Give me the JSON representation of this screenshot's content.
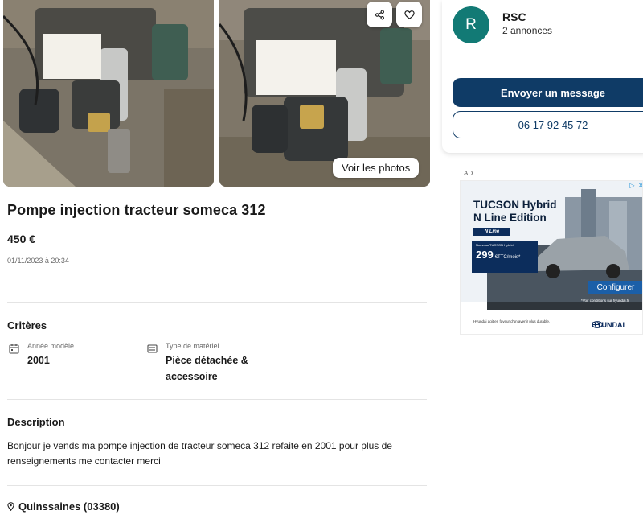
{
  "gallery": {
    "see_photos_label": "Voir les photos",
    "photo1_handwritten": "Pompe injection someca 312 pompe refaite 2001",
    "photo2_handwritten": "Pompe injection someca 312 pompe refaite 2001"
  },
  "listing": {
    "title": "Pompe injection tracteur someca 312",
    "price": "450 €",
    "date": "01/11/2023 à 20:34"
  },
  "criteria": {
    "section_title": "Critères",
    "items": [
      {
        "label": "Année modèle",
        "value": "2001",
        "icon": "calendar-icon"
      },
      {
        "label": "Type de matériel",
        "value": "Pièce détachée & accessoire",
        "icon": "list-icon"
      }
    ]
  },
  "description": {
    "section_title": "Description",
    "text": "Bonjour je vends ma pompe injection de tracteur someca 312 refaite en 2001 pour plus de renseignements me contacter merci"
  },
  "location": {
    "text": "Quinssaines  (03380)",
    "icon": "location-pin-icon"
  },
  "seller": {
    "initial": "R",
    "name": "RSC",
    "listings_count": "2 annonces",
    "message_button": "Envoyer un message",
    "phone": "06 17 92 45 72",
    "avatar_color": "#127a75",
    "primary_color": "#0f3b66"
  },
  "ad": {
    "label": "AD",
    "headline_line1": "TUCSON Hybrid",
    "headline_line2": "N Line Edition",
    "badge": "N Line",
    "box_caption": "Nouveau TUCSON Hybrid",
    "box_price": "299",
    "box_unit": "€TTC/mois*",
    "cta": "Configurer",
    "conditions": "*Voir conditions sur hyundai.fr",
    "footer": "Hyundai agit en faveur d'un avenir plus durable.",
    "brand": "HYUNDAI"
  }
}
